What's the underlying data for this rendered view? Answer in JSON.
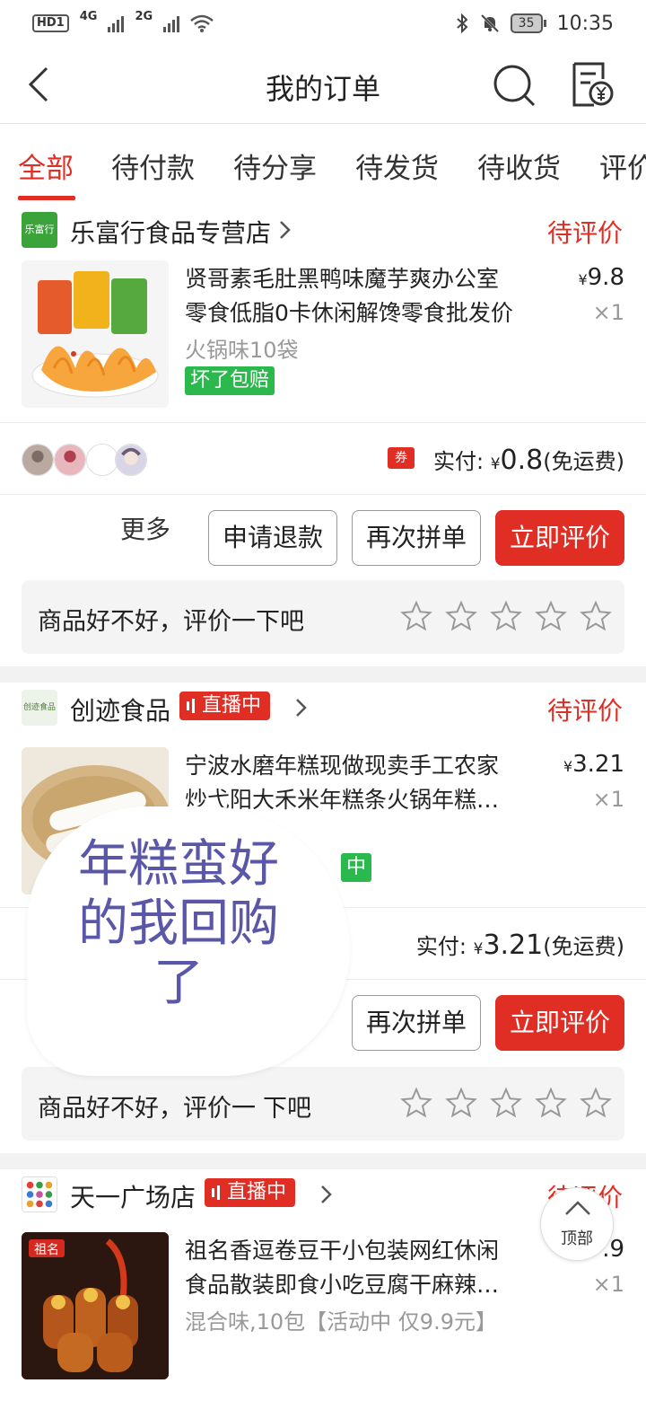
{
  "status_bar": {
    "left_chip": "HD1",
    "net1": "4G",
    "net2": "2G",
    "battery": "35",
    "time": "10:35"
  },
  "navbar": {
    "title": "我的订单",
    "icons": [
      "back-icon",
      "search-icon",
      "invoice-icon"
    ]
  },
  "tabs": [
    {
      "label": "全部",
      "active": true
    },
    {
      "label": "待付款"
    },
    {
      "label": "待分享"
    },
    {
      "label": "待发货"
    },
    {
      "label": "待收货"
    },
    {
      "label": "评价"
    }
  ],
  "orders": [
    {
      "shop_name": "乐富行食品专营店",
      "shop_logo_text": "乐富行",
      "status": "待评价",
      "product_title_line1": "贤哥素毛肚黑鸭味魔芋爽办公室",
      "product_title_line2": "零食低脂0卡休闲解馋零食批发价",
      "price_yen": "¥",
      "price": "9.8",
      "qty": "×1",
      "spec": "火锅味10袋",
      "tag": "坏了包赔",
      "coupon": "券",
      "paid_label": "实付:",
      "paid_yen": "¥",
      "paid_amount": "0.8",
      "shipping": "(免运费)",
      "more": "更多",
      "btn_refund": "申请退款",
      "btn_reorder": "再次拼单",
      "btn_review": "立即评价",
      "rate_prompt": "商品好不好，评价一下吧"
    },
    {
      "shop_name": "创迹食品",
      "shop_logo_text": "创迹食品",
      "live": "直播中",
      "status": "待评价",
      "product_title_line1": "宁波水磨年糕现做现卖手工农家",
      "product_title_line2": "炒弋阳大禾米年糕条火锅年糕…",
      "price_yen": "¥",
      "price": "3.21",
      "qty": "×1",
      "tag_partial": "中",
      "paid_label": "实付:",
      "paid_yen": "¥",
      "paid_amount": "3.21",
      "shipping": "(免运费)",
      "btn_reorder": "再次拼单",
      "btn_review": "立即评价",
      "rate_prompt_left": "商品好不好，评价一",
      "rate_prompt_right": "下吧"
    },
    {
      "shop_name": "天一广场店",
      "live": "直播中",
      "status_partial": "待评价",
      "product_title_line1": "祖名香逗卷豆干小包装网红休闲",
      "product_title_line2": "食品散装即食小吃豆腐干麻辣…",
      "price_partial": ".9",
      "qty": "×1",
      "spec": "混合味,10包【活动中 仅9.9元】",
      "thumb_brand": "祖名"
    }
  ],
  "sticker": {
    "lines": [
      "年糕蛮好",
      "的我回购",
      "了"
    ]
  },
  "back_to_top": "顶部",
  "colors": {
    "accent": "#e02e24",
    "green_tag": "#2bb84c",
    "sticker_text": "#5a57a8"
  }
}
